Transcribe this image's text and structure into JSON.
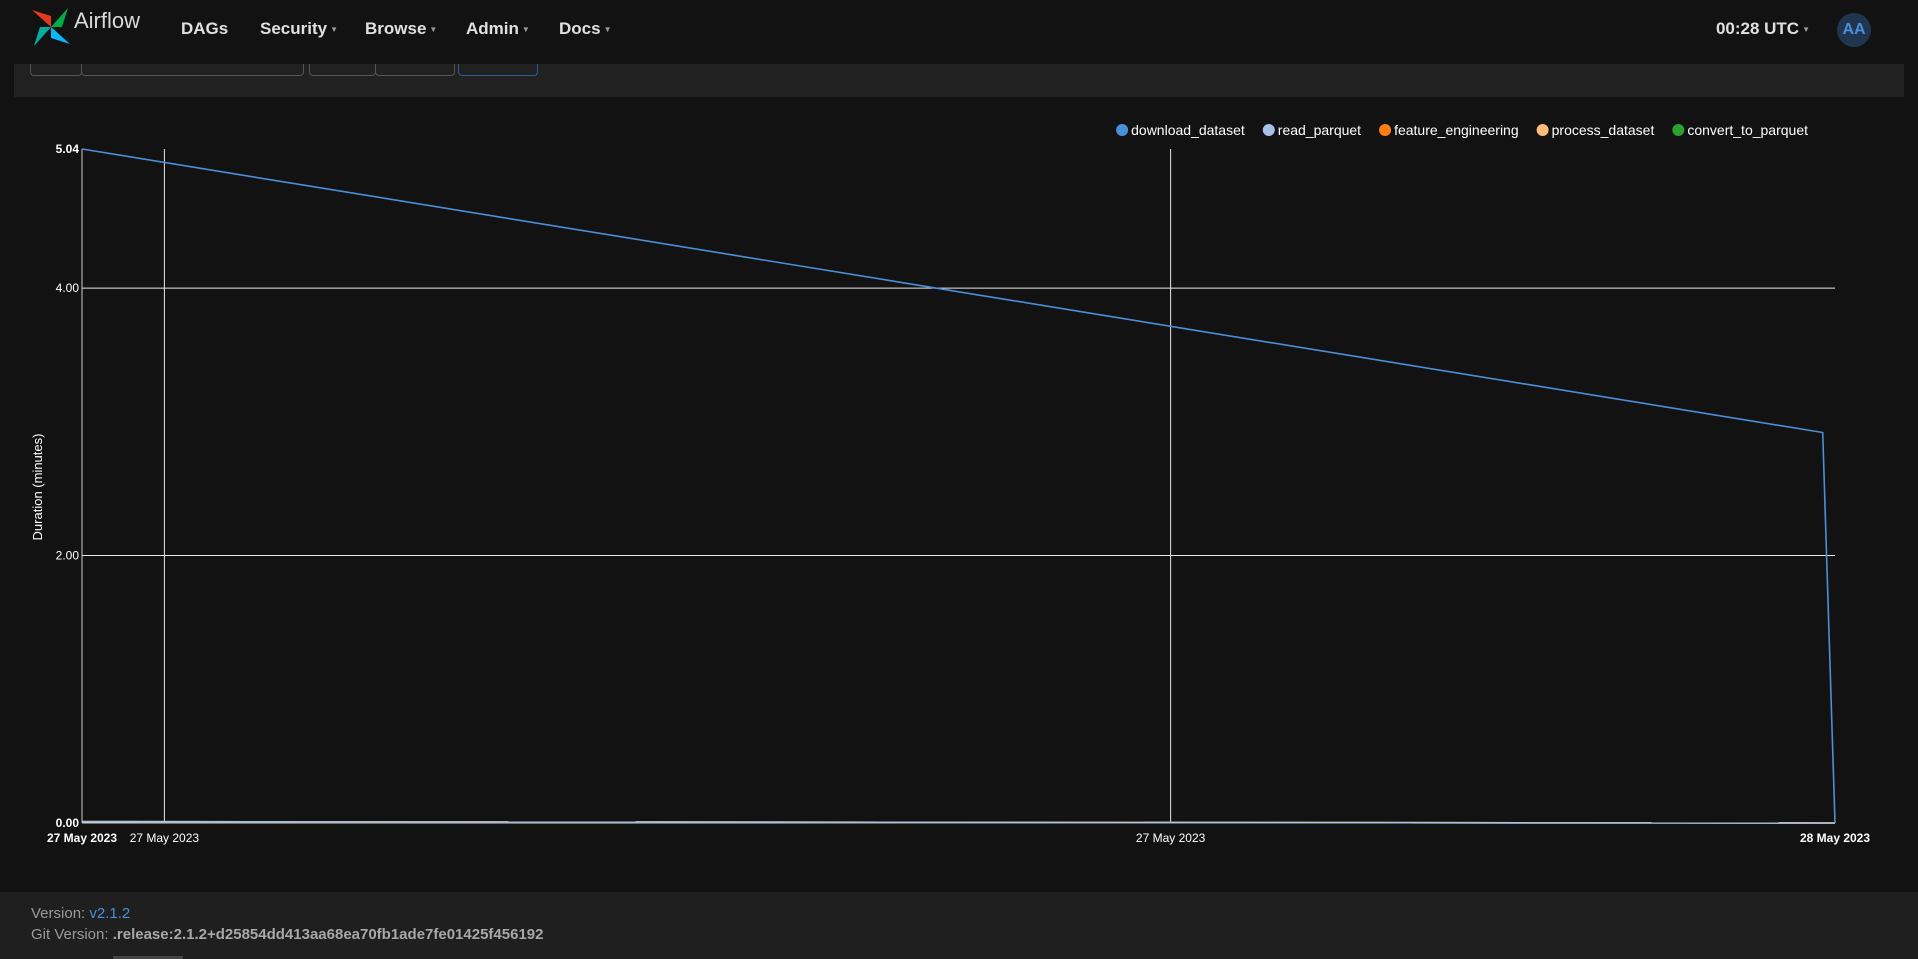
{
  "navbar": {
    "brand": "Airflow",
    "items": [
      {
        "label": "DAGs",
        "dropdown": false
      },
      {
        "label": "Security",
        "dropdown": true
      },
      {
        "label": "Browse",
        "dropdown": true
      },
      {
        "label": "Admin",
        "dropdown": true
      },
      {
        "label": "Docs",
        "dropdown": true
      }
    ],
    "clock": "00:28 UTC",
    "avatar_initials": "AA"
  },
  "chart_data": {
    "type": "line",
    "ylabel": "Duration (minutes)",
    "ylim": [
      0,
      5.04
    ],
    "y_ticks": [
      "0.00",
      "2.00",
      "4.00",
      "5.04"
    ],
    "x_tick_labels": [
      "27 May 2023",
      "27 May 2023",
      "27 May 2023",
      "28 May 2023"
    ],
    "legend_position": "top-right",
    "grid": true,
    "series": [
      {
        "name": "download_dataset",
        "color": "#4a90d9",
        "x": [
          0,
          0.993,
          1
        ],
        "values": [
          5.04,
          2.92,
          0.0
        ]
      },
      {
        "name": "read_parquet",
        "color": "#a6c1e6",
        "x": [
          0,
          1
        ],
        "values": [
          0.01,
          0.0
        ]
      },
      {
        "name": "feature_engineering",
        "color": "#ff7f0e",
        "x": [
          0,
          1
        ],
        "values": [
          0.01,
          0.0
        ]
      },
      {
        "name": "process_dataset",
        "color": "#ffbb78",
        "x": [
          0,
          1
        ],
        "values": [
          0.01,
          0.0
        ]
      },
      {
        "name": "convert_to_parquet",
        "color": "#2ca02c",
        "x": [
          0,
          1
        ],
        "values": [
          0.01,
          0.0
        ]
      }
    ]
  },
  "footer": {
    "version_label": "Version:",
    "version_value": "v2.1.2",
    "git_label": "Git Version:",
    "git_value": ".release:2.1.2+d25854dd413aa68ea70fb1ade7fe01425f456192"
  }
}
